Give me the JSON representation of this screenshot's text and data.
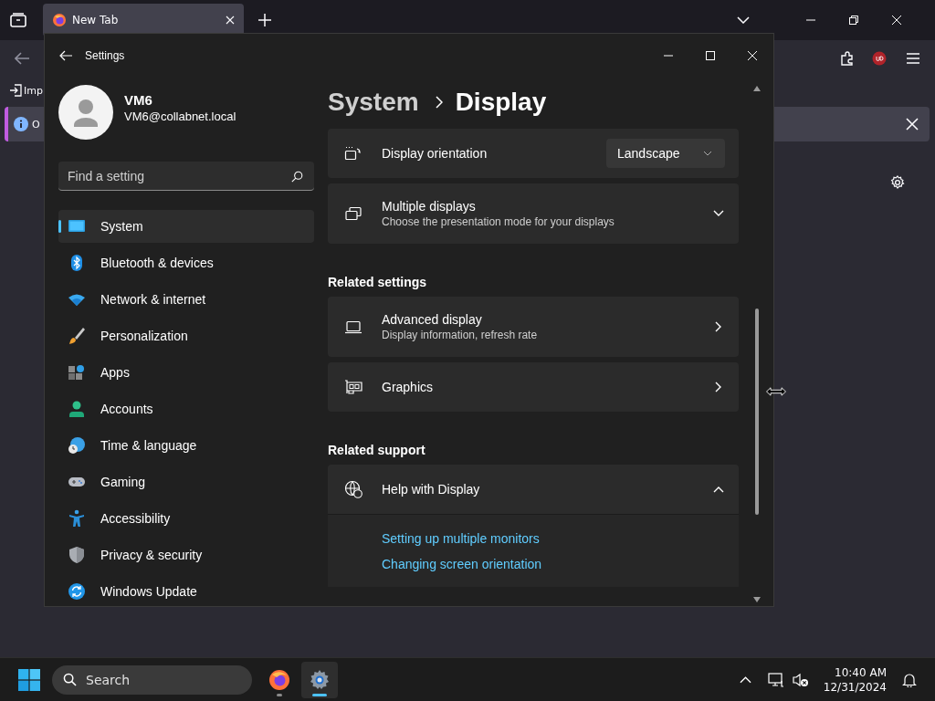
{
  "browser": {
    "tab": {
      "title": "New Tab",
      "selected": true
    },
    "bookmarks_bar": {
      "item": "Imp"
    },
    "notification": {
      "text": "O"
    }
  },
  "settings": {
    "window": {
      "title": "Settings"
    },
    "user": {
      "name": "VM6",
      "email": "VM6@collabnet.local"
    },
    "search": {
      "placeholder": "Find a setting"
    },
    "nav": [
      {
        "label": "System",
        "selected": true
      },
      {
        "label": "Bluetooth & devices",
        "selected": false
      },
      {
        "label": "Network & internet",
        "selected": false
      },
      {
        "label": "Personalization",
        "selected": false
      },
      {
        "label": "Apps",
        "selected": false
      },
      {
        "label": "Accounts",
        "selected": false
      },
      {
        "label": "Time & language",
        "selected": false
      },
      {
        "label": "Gaming",
        "selected": false
      },
      {
        "label": "Accessibility",
        "selected": false
      },
      {
        "label": "Privacy & security",
        "selected": false
      },
      {
        "label": "Windows Update",
        "selected": false
      }
    ],
    "breadcrumb": [
      "System",
      "Display"
    ],
    "content": [
      {
        "kind": "dropdown_row",
        "title": "Display orientation",
        "value": "Landscape"
      },
      {
        "kind": "expander_row",
        "title": "Multiple displays",
        "subtitle": "Choose the presentation mode for your displays",
        "expanded": false
      },
      {
        "kind": "heading",
        "title": "Related settings"
      },
      {
        "kind": "link_row",
        "title": "Advanced display",
        "subtitle": "Display information, refresh rate"
      },
      {
        "kind": "link_row",
        "title": "Graphics"
      },
      {
        "kind": "heading",
        "title": "Related support"
      },
      {
        "kind": "expander_row",
        "title": "Help with Display",
        "expanded": true,
        "links": [
          "Setting up multiple monitors",
          "Changing screen orientation"
        ]
      }
    ]
  },
  "taskbar": {
    "search": {
      "placeholder": "Search"
    },
    "apps": [
      {
        "selected": false
      },
      {
        "selected": true
      }
    ],
    "clock": {
      "time": "10:40 AM",
      "date": "12/31/2024"
    }
  }
}
